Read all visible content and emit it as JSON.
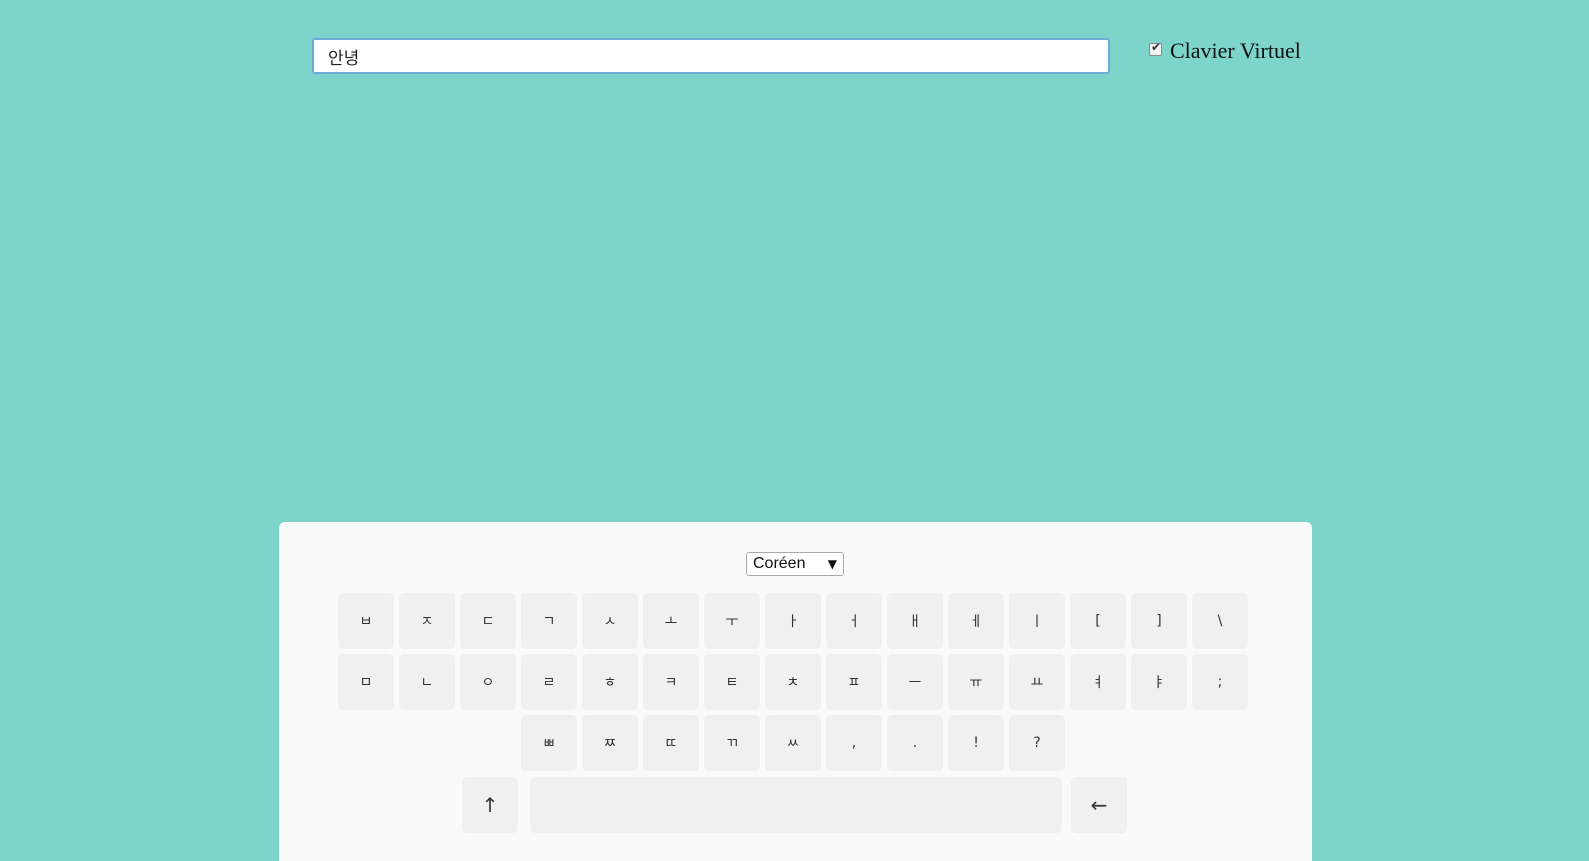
{
  "input": {
    "value": "안녕"
  },
  "toggle": {
    "label": "Clavier Virtuel",
    "checked": true
  },
  "keyboard": {
    "language": "Coréen",
    "rows": [
      [
        "ㅂ",
        "ㅈ",
        "ㄷ",
        "ㄱ",
        "ㅅ",
        "ㅗ",
        "ㅜ",
        "ㅏ",
        "ㅓ",
        "ㅐ",
        "ㅔ",
        "ㅣ",
        "[",
        "]",
        "\\"
      ],
      [
        "ㅁ",
        "ㄴ",
        "ㅇ",
        "ㄹ",
        "ㅎ",
        "ㅋ",
        "ㅌ",
        "ㅊ",
        "ㅍ",
        "ㅡ",
        "ㅠ",
        "ㅛ",
        "ㅕ",
        "ㅑ",
        ";"
      ],
      [
        "ㅃ",
        "ㅉ",
        "ㄸ",
        "ㄲ",
        "ㅆ",
        ",",
        ".",
        "!",
        "?"
      ]
    ],
    "shift_label": "↑",
    "backspace_label": "←"
  }
}
